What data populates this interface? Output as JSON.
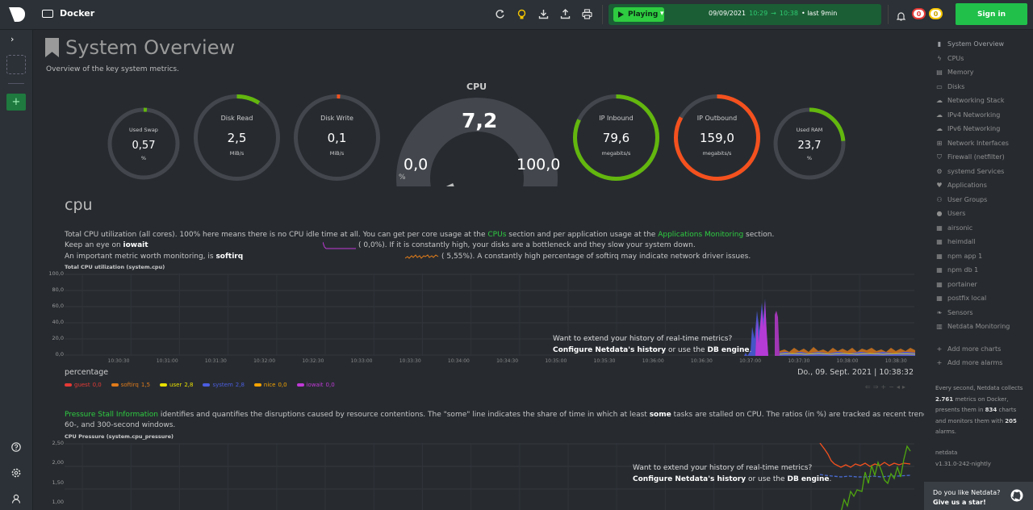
{
  "topbar": {
    "space_name": "Docker",
    "icons": [
      "reload-icon",
      "bulb-icon",
      "download-icon",
      "upload-icon",
      "print-icon"
    ],
    "player": {
      "status": "Playing",
      "date": "09/09/2021",
      "time_from": "10:29",
      "arrow": "→",
      "time_to": "10:38",
      "range": "• last 9min"
    },
    "alarms_critical": "0",
    "alarms_warning": "0",
    "signin_label": "Sign in"
  },
  "page": {
    "title": "System Overview",
    "subtitle": "Overview of the key system metrics."
  },
  "gauges": {
    "swap": {
      "label": "Used Swap",
      "value": "0,57",
      "unit": "%",
      "fraction": 0.0057
    },
    "disk_read": {
      "label": "Disk Read",
      "value": "2,5",
      "unit": "MiB/s",
      "fraction": 0.09
    },
    "disk_write": {
      "label": "Disk Write",
      "value": "0,1",
      "unit": "MiB/s",
      "fraction": 0.01
    },
    "cpu": {
      "title": "CPU",
      "value": "7,2",
      "min": "0,0",
      "max": "100,0",
      "unit": "%",
      "fraction": 0.072
    },
    "ip_in": {
      "label": "IP Inbound",
      "value": "79,6",
      "unit": "megabits/s",
      "fraction": 0.82
    },
    "ip_out": {
      "label": "IP Outbound",
      "value": "159,0",
      "unit": "megabits/s",
      "fraction": 0.83
    },
    "ram": {
      "label": "Used RAM",
      "value": "23,7",
      "unit": "%",
      "fraction": 0.237
    }
  },
  "cpu_section": {
    "heading": "cpu",
    "p1_a": "Total CPU utilization (all cores). 100% here means there is no CPU idle time at all. You can get per core usage at the ",
    "p1_link1": "CPUs",
    "p1_b": " section and per application usage at the ",
    "p1_link2": "Applications Monitoring",
    "p1_c": " section.",
    "p2_a": "Keep an eye on ",
    "p2_bold": "iowait",
    "p2_val": "(        0,0%). If it is constantly high, your disks are a bottleneck and they slow your system down.",
    "p3_a": "An important metric worth monitoring, is ",
    "p3_bold": "softirq",
    "p3_val": "(      5,55%). A constantly high percentage of softirq may indicate network driver issues.",
    "chart_title": "Total CPU utilization (system.cpu)",
    "yticks": [
      "100,0",
      "80,0",
      "60,0",
      "40,0",
      "20,0",
      "0,0"
    ],
    "xticks": [
      "10:30:30",
      "10:31:00",
      "10:31:30",
      "10:32:00",
      "10:32:30",
      "10:33:00",
      "10:33:30",
      "10:34:00",
      "10:34:30",
      "10:35:00",
      "10:35:30",
      "10:36:00",
      "10:36:30",
      "10:37:00",
      "10:37:30",
      "10:38:00",
      "10:38:30"
    ],
    "history_line1": "Want to extend your history of real-time metrics?",
    "history_l2a": "Configure Netdata's ",
    "history_l2b": "history",
    "history_l2c": " or use the ",
    "history_l2d": "DB engine",
    "history_l2e": ".",
    "unit": "percentage",
    "date": "Do., 09. Sept. 2021 | 10:38:32",
    "legend": [
      {
        "name": "guest",
        "value": "0,0",
        "color": "#e53935"
      },
      {
        "name": "softirq",
        "value": "1,5",
        "color": "#e07b1a"
      },
      {
        "name": "user",
        "value": "2,8",
        "color": "#e8e000"
      },
      {
        "name": "system",
        "value": "2,8",
        "color": "#4b5de0"
      },
      {
        "name": "nice",
        "value": "0,0",
        "color": "#f5a300"
      },
      {
        "name": "iowait",
        "value": "0,0",
        "color": "#c039d6"
      }
    ]
  },
  "psi_section": {
    "link": "Pressure Stall Information",
    "p_a": " identifies and quantifies the disruptions caused by resource contentions. The \"some\" line indicates the share of time in which at least ",
    "p_bold": "some",
    "p_b": " tasks are stalled on CPU. The ratios (in %) are tracked as recent trends over 10-,",
    "p_line2": "60-, and 300-second windows.",
    "chart_title": "CPU Pressure (system.cpu_pressure)",
    "yticks": [
      "2,50",
      "2,00",
      "1,50",
      "1,00"
    ]
  },
  "sidebar": {
    "items": [
      {
        "label": "System Overview",
        "icon": "bookmark-icon"
      },
      {
        "label": "CPUs",
        "icon": "bolt-icon"
      },
      {
        "label": "Memory",
        "icon": "memory-icon"
      },
      {
        "label": "Disks",
        "icon": "hdd-icon"
      },
      {
        "label": "Networking Stack",
        "icon": "cloud-icon"
      },
      {
        "label": "IPv4 Networking",
        "icon": "cloud-icon"
      },
      {
        "label": "IPv6 Networking",
        "icon": "cloud-icon"
      },
      {
        "label": "Network Interfaces",
        "icon": "sitemap-icon"
      },
      {
        "label": "Firewall (netfilter)",
        "icon": "shield-icon"
      },
      {
        "label": "systemd Services",
        "icon": "cogs-icon"
      },
      {
        "label": "Applications",
        "icon": "heartbeat-icon"
      },
      {
        "label": "User Groups",
        "icon": "users-icon"
      },
      {
        "label": "Users",
        "icon": "user-icon"
      },
      {
        "label": "airsonic",
        "icon": "th-icon"
      },
      {
        "label": "heimdall",
        "icon": "th-icon"
      },
      {
        "label": "npm app 1",
        "icon": "th-icon"
      },
      {
        "label": "npm db 1",
        "icon": "th-icon"
      },
      {
        "label": "portainer",
        "icon": "th-icon"
      },
      {
        "label": "postfix local",
        "icon": "th-icon"
      },
      {
        "label": "Sensors",
        "icon": "leaf-icon"
      },
      {
        "label": "Netdata Monitoring",
        "icon": "bar-chart-icon"
      }
    ],
    "add_charts": "Add more charts",
    "add_alarms": "Add more alarms",
    "info_a": "Every second, Netdata collects ",
    "info_metrics": "2.761",
    "info_b": " metrics on Docker, presents them in ",
    "info_charts": "834",
    "info_c": " charts and monitors them with ",
    "info_alarms": "205",
    "info_d": " alarms.",
    "version_heading": "netdata",
    "version": "v1.31.0-242-nightly",
    "star_line1": "Do you like Netdata?",
    "star_line2": "Give us a star!"
  },
  "leftbar": {
    "bottom_icons": [
      "help-icon",
      "settings-icon",
      "user-icon"
    ]
  }
}
